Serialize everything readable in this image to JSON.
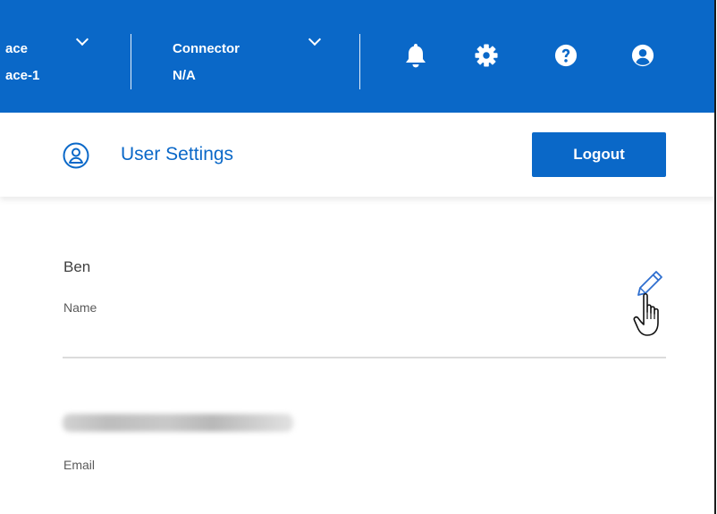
{
  "topbar": {
    "workspace": {
      "line1": "ace",
      "line2": "ace-1"
    },
    "connector": {
      "label": "Connector",
      "value": "N/A"
    },
    "icons": [
      "bell-icon",
      "gear-icon",
      "help-icon",
      "user-icon"
    ]
  },
  "header": {
    "title": "User Settings",
    "logout_label": "Logout"
  },
  "profile": {
    "name": {
      "value": "Ben",
      "label": "Name"
    },
    "email": {
      "label": "Email"
    }
  },
  "colors": {
    "brand": "#0a68c8",
    "divider": "#dcdcdc",
    "text": "#404040"
  }
}
